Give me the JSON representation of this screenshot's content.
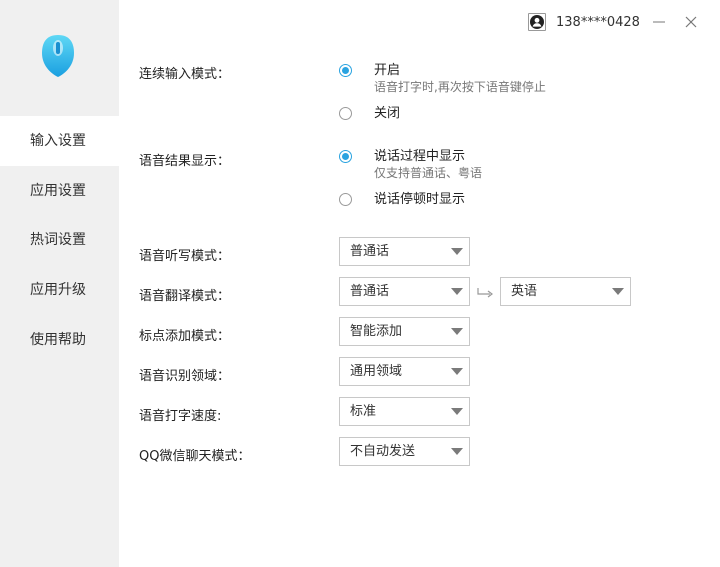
{
  "user": {
    "phone": "138****0428"
  },
  "sidebar": {
    "items": [
      {
        "label": "输入设置"
      },
      {
        "label": "应用设置"
      },
      {
        "label": "热词设置"
      },
      {
        "label": "应用升级"
      },
      {
        "label": "使用帮助"
      }
    ],
    "active_index": 0
  },
  "settings": {
    "continuous": {
      "label": "连续输入模式：",
      "options": [
        {
          "main": "开启",
          "sub": "语音打字时,再次按下语音键停止",
          "checked": true
        },
        {
          "main": "关闭",
          "checked": false
        }
      ]
    },
    "result_display": {
      "label": "语音结果显示：",
      "options": [
        {
          "main": "说话过程中显示",
          "sub": "仅支持普通话、粤语",
          "checked": true
        },
        {
          "main": "说话停顿时显示",
          "checked": false
        }
      ]
    },
    "dictation": {
      "label": "语音听写模式：",
      "value": "普通话"
    },
    "translation": {
      "label": "语音翻译模式：",
      "from": "普通话",
      "to": "英语"
    },
    "punctuation": {
      "label": "标点添加模式：",
      "value": "智能添加"
    },
    "domain": {
      "label": "语音识别领域：",
      "value": "通用领域"
    },
    "speed": {
      "label": "语音打字速度:",
      "value": "标准"
    },
    "chat_mode": {
      "label": "QQ微信聊天模式：",
      "value": "不自动发送"
    }
  },
  "colors": {
    "accent": "#2aa3e0",
    "sidebar_bg": "#f0f0f0"
  },
  "icons": {
    "logo": "microphone-logo-icon",
    "avatar": "user-avatar-icon",
    "minimize": "minimize-icon",
    "close": "close-icon",
    "swap": "translate-arrow-icon"
  }
}
